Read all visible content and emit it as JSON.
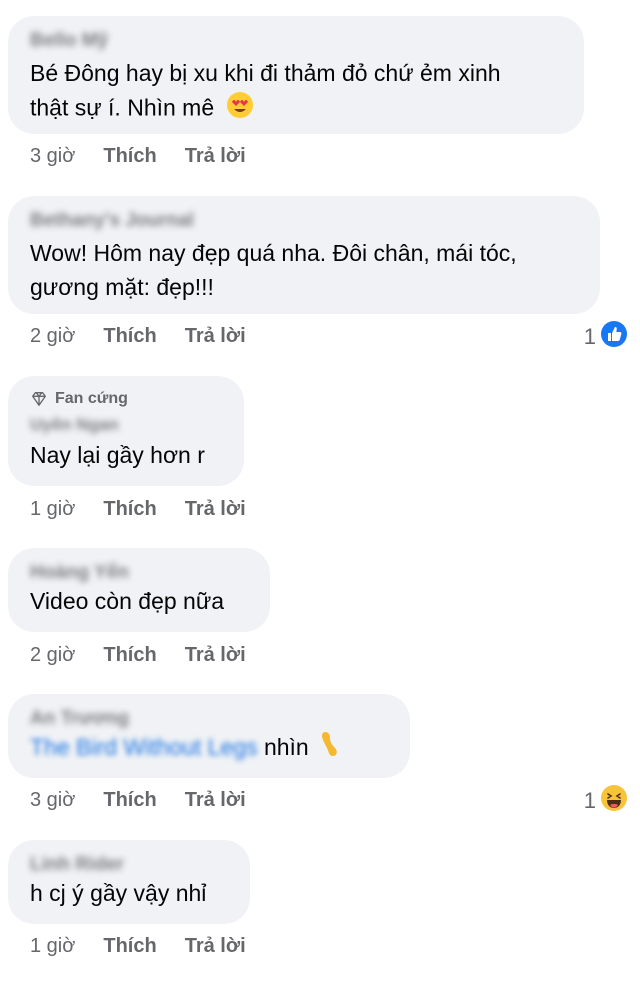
{
  "comments": [
    {
      "author": "Bello Mỹ",
      "text_line1": "Bé Đông hay bị xu khi đi thảm đỏ chứ ẻm xinh",
      "text_line2": "thật sự í. Nhìn mê",
      "time": "3 giờ",
      "like": "Thích",
      "reply": "Trả lời"
    },
    {
      "author": "Bethany's Journal",
      "text_line1": "Wow! Hôm nay đẹp quá nha. Đôi chân, mái tóc,",
      "text_line2": "gương mặt: đẹp!!!",
      "time": "2 giờ",
      "like": "Thích",
      "reply": "Trả lời",
      "reaction_count": "1",
      "reaction_icon": "like-icon"
    },
    {
      "badge": "Fan cứng",
      "author": "Uyên Ngan",
      "text_line1": "Nay lại gầy hơn r",
      "time": "1 giờ",
      "like": "Thích",
      "reply": "Trả lời"
    },
    {
      "author": "Hoàng Yến",
      "text_line1": "Video còn đẹp nữa",
      "time": "2 giờ",
      "like": "Thích",
      "reply": "Trả lời"
    },
    {
      "author": "An Trương",
      "mention": "The Bird Without Legs",
      "text_after": " nhìn",
      "time": "3 giờ",
      "like": "Thích",
      "reply": "Trả lời",
      "reaction_count": "1",
      "reaction_icon": "haha-icon"
    },
    {
      "author": "Linh Rider",
      "text_line1": "h cj ý gầy vậy nhỉ",
      "time": "1 giờ",
      "like": "Thích",
      "reply": "Trả lời"
    }
  ],
  "colors": {
    "bubble": "#f0f2f5",
    "meta": "#65676b",
    "link": "#1b74e4",
    "like_blue": "#1877f2"
  }
}
